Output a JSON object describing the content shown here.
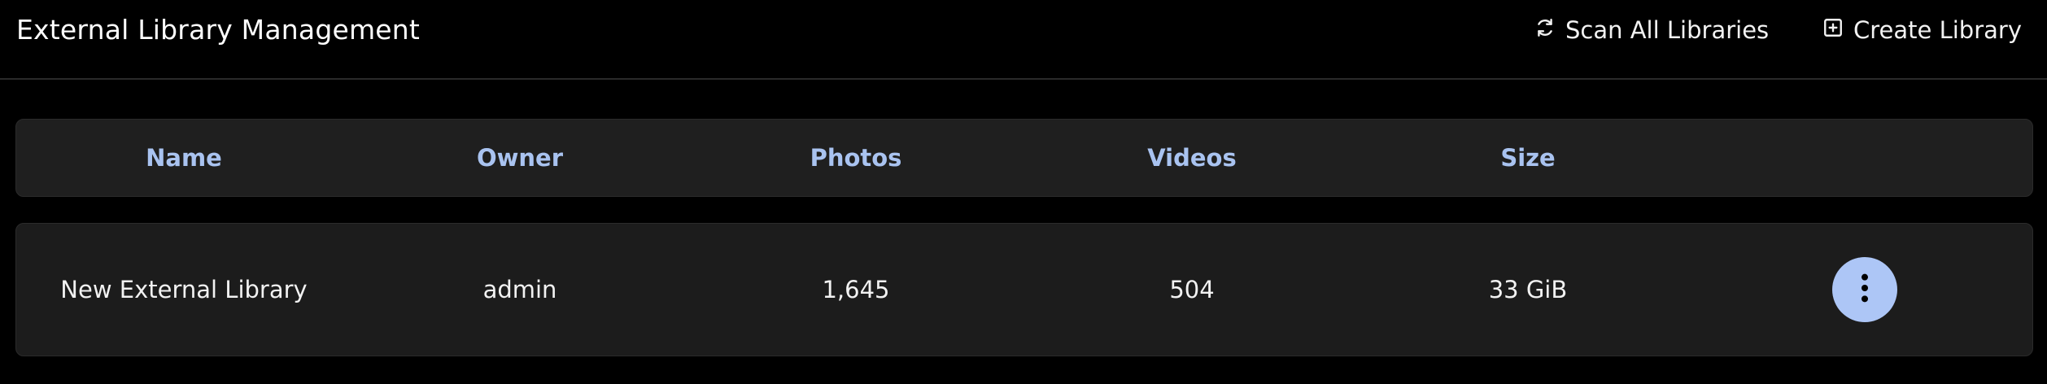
{
  "header": {
    "title": "External Library Management",
    "scan_all_label": "Scan All Libraries",
    "create_label": "Create Library"
  },
  "table": {
    "columns": [
      "Name",
      "Owner",
      "Photos",
      "Videos",
      "Size"
    ],
    "rows": [
      {
        "name": "New External Library",
        "owner": "admin",
        "photos": "1,645",
        "videos": "504",
        "size": "33 GiB",
        "action_icon": "dots-vertical-icon"
      }
    ]
  },
  "colors": {
    "background": "#000000",
    "panel": "#1f1f1f",
    "header_text": "#a9c3f0",
    "accent_button": "#adc6f6"
  },
  "icons": {
    "scan": "refresh-icon",
    "create": "plus-square-icon",
    "row_menu": "dots-vertical-icon"
  }
}
